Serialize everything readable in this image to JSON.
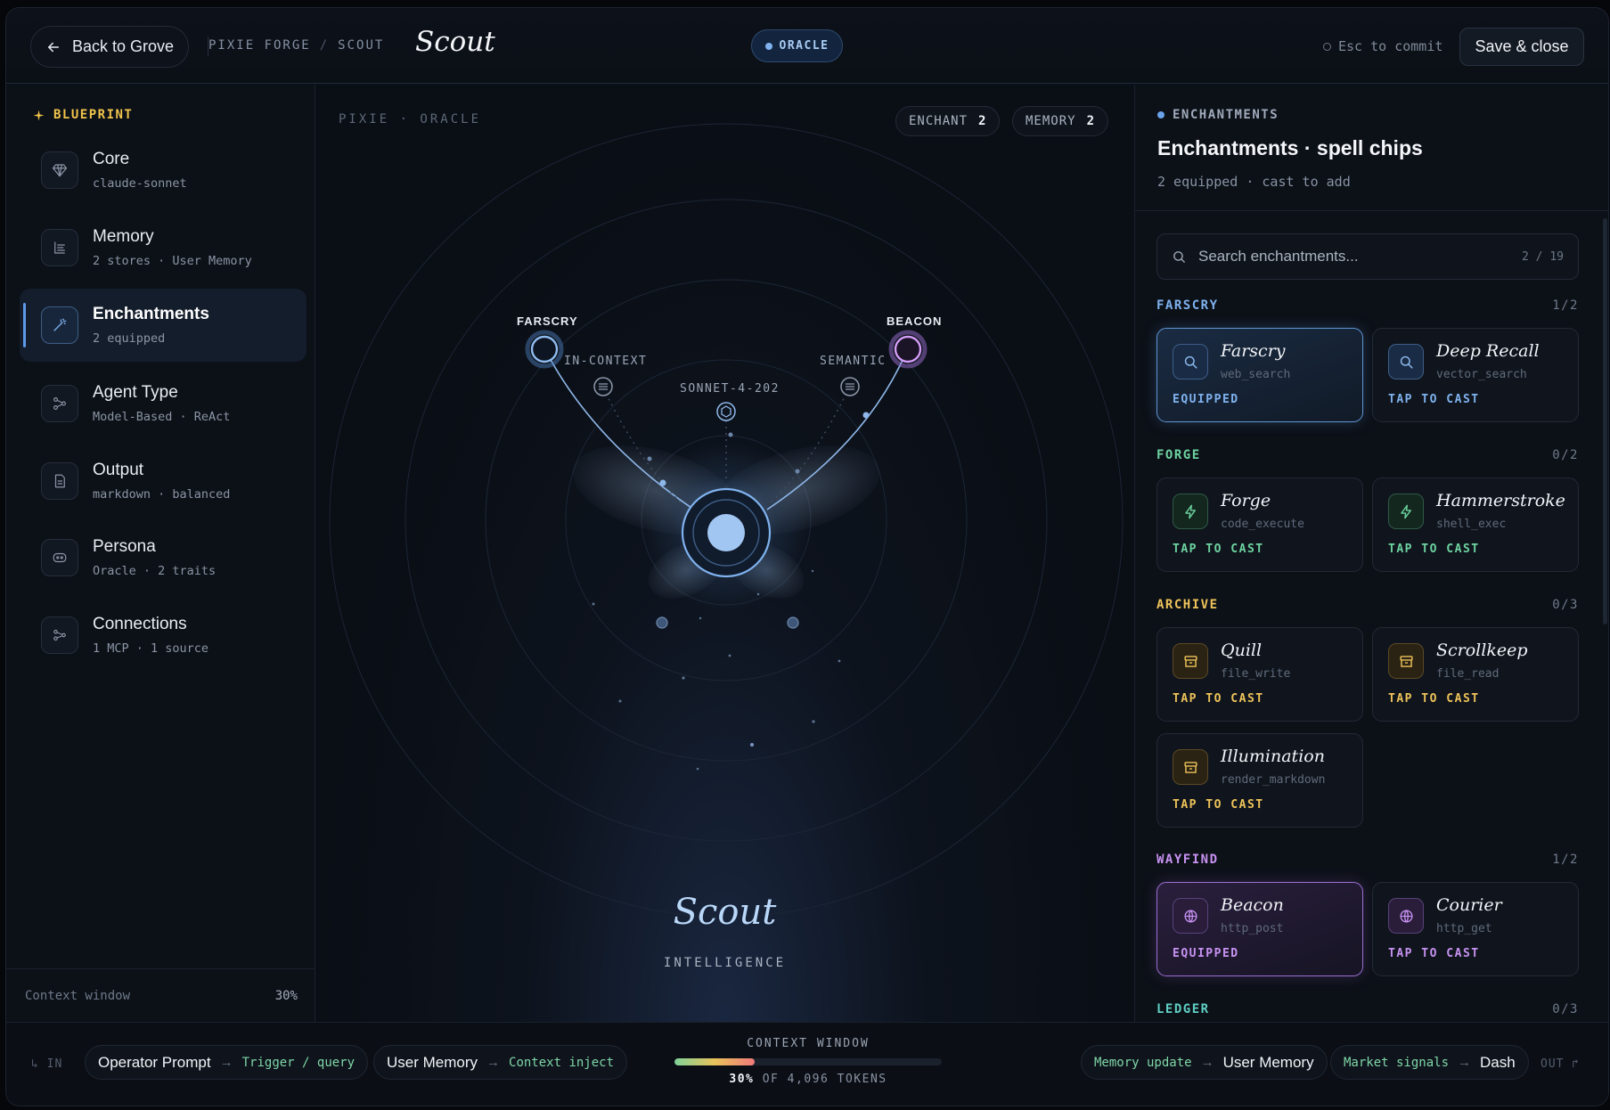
{
  "topbar": {
    "back_label": "Back to Grove",
    "crumb_root": "PIXIE FORGE",
    "crumb_sep": "/",
    "crumb_leaf": "SCOUT",
    "title": "Scout",
    "mode_pill": "ORACLE",
    "esc_hint": "Esc to commit",
    "save_label": "Save & close"
  },
  "sidebar": {
    "heading": "BLUEPRINT",
    "items": [
      {
        "label": "Core",
        "sub": "claude-sonnet"
      },
      {
        "label": "Memory",
        "sub": "2 stores · User Memory"
      },
      {
        "label": "Enchantments",
        "sub": "2 equipped"
      },
      {
        "label": "Agent Type",
        "sub": "Model-Based · ReAct"
      },
      {
        "label": "Output",
        "sub": "markdown · balanced"
      },
      {
        "label": "Persona",
        "sub": "Oracle · 2 traits"
      },
      {
        "label": "Connections",
        "sub": "1 MCP · 1 source"
      }
    ],
    "footer_label": "Context window",
    "footer_value": "30%"
  },
  "canvas": {
    "label": "PIXIE · ORACLE",
    "chip_enchant_label": "ENCHANT",
    "chip_enchant_count": "2",
    "chip_memory_label": "MEMORY",
    "chip_memory_count": "2",
    "node_left": "FARSCRY",
    "node_right": "BEACON",
    "mini_left": "IN-CONTEXT",
    "mini_center": "SONNET-4-202",
    "mini_right": "SEMANTIC",
    "name": "Scout",
    "caption": "INTELLIGENCE"
  },
  "panel": {
    "tag": "ENCHANTMENTS",
    "title": "Enchantments · spell chips",
    "subtitle": "2 equipped · cast to add",
    "search_placeholder": "Search enchantments...",
    "search_count": "2 / 19",
    "groups": [
      {
        "name": "FARSCRY",
        "count": "1/2",
        "color": "#7fb2ee",
        "cards": [
          {
            "name": "Farscry",
            "tool": "web_search",
            "status": "EQUIPPED",
            "icon": "search-icon"
          },
          {
            "name": "Deep Recall",
            "tool": "vector_search",
            "status": "TAP TO CAST",
            "icon": "search-icon"
          }
        ]
      },
      {
        "name": "FORGE",
        "count": "0/2",
        "color": "#6dd3a0",
        "cards": [
          {
            "name": "Forge",
            "tool": "code_execute",
            "status": "TAP TO CAST",
            "icon": "bolt-icon"
          },
          {
            "name": "Hammerstroke",
            "tool": "shell_exec",
            "status": "TAP TO CAST",
            "icon": "bolt-icon"
          }
        ]
      },
      {
        "name": "ARCHIVE",
        "count": "0/3",
        "color": "#eec35a",
        "cards": [
          {
            "name": "Quill",
            "tool": "file_write",
            "status": "TAP TO CAST",
            "icon": "archive-icon"
          },
          {
            "name": "Scrollkeep",
            "tool": "file_read",
            "status": "TAP TO CAST",
            "icon": "archive-icon"
          },
          {
            "name": "Illumination",
            "tool": "render_markdown",
            "status": "TAP TO CAST",
            "icon": "archive-icon"
          }
        ]
      },
      {
        "name": "WAYFIND",
        "count": "1/2",
        "color": "#c792f2",
        "cards": [
          {
            "name": "Beacon",
            "tool": "http_post",
            "status": "EQUIPPED",
            "icon": "globe-icon"
          },
          {
            "name": "Courier",
            "tool": "http_get",
            "status": "TAP TO CAST",
            "icon": "globe-icon"
          }
        ]
      },
      {
        "name": "LEDGER",
        "count": "0/3",
        "color": "#5fd0c4",
        "cards": []
      }
    ]
  },
  "bottombar": {
    "in_label": "↳ IN",
    "in_chip1_name": "Operator Prompt",
    "in_chip1_arrow": "→",
    "in_chip1_target": "Trigger / query",
    "in_chip2_name": "User Memory",
    "in_chip2_arrow": "→",
    "in_chip2_target": "Context inject",
    "ctx_title": "CONTEXT WINDOW",
    "ctx_percent": "30%",
    "ctx_percent_value": 0.3,
    "ctx_tokens": "OF 4,096 TOKENS",
    "out_chip1_source": "Memory update",
    "out_chip1_arrow": "→",
    "out_chip1_name": "User Memory",
    "out_chip2_source": "Market signals",
    "out_chip2_arrow": "→",
    "out_chip2_name": "Dash",
    "out_label": "OUT ↱"
  }
}
